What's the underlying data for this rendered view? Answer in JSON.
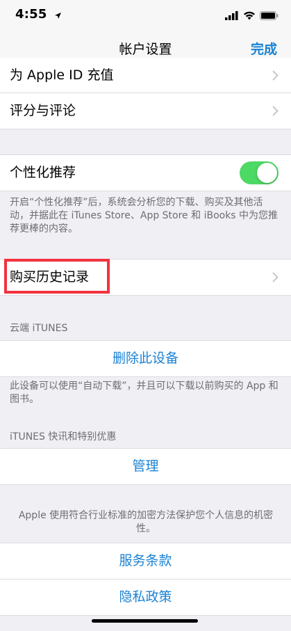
{
  "status": {
    "time": "4:55"
  },
  "nav": {
    "title": "帐户设置",
    "done": "完成"
  },
  "group1": {
    "row1": "为 Apple ID 充值",
    "row2": "评分与评论"
  },
  "personalization": {
    "label": "个性化推荐",
    "enabled": true,
    "note": "开启“个性化推荐”后，系统会分析您的下载、购买及其他活动，并据此在 iTunes Store、App Store 和 iBooks 中为您推荐更棒的内容。"
  },
  "purchase_history": {
    "label": "购买历史记录"
  },
  "cloud": {
    "header": "云端 iTUNES",
    "remove_device": "删除此设备",
    "note": "此设备可以使用“自动下载”，并且可以下载以前购买的 App 和图书。"
  },
  "news": {
    "header": "iTUNES 快讯和特别优惠",
    "manage": "管理"
  },
  "privacy": {
    "note": "Apple 使用符合行业标准的加密方法保护您个人信息的机密性。",
    "terms": "服务条款",
    "policy": "隐私政策"
  },
  "colors": {
    "accent": "#1a82d4",
    "toggle_on": "#4cd964",
    "highlight": "#f2323f"
  }
}
